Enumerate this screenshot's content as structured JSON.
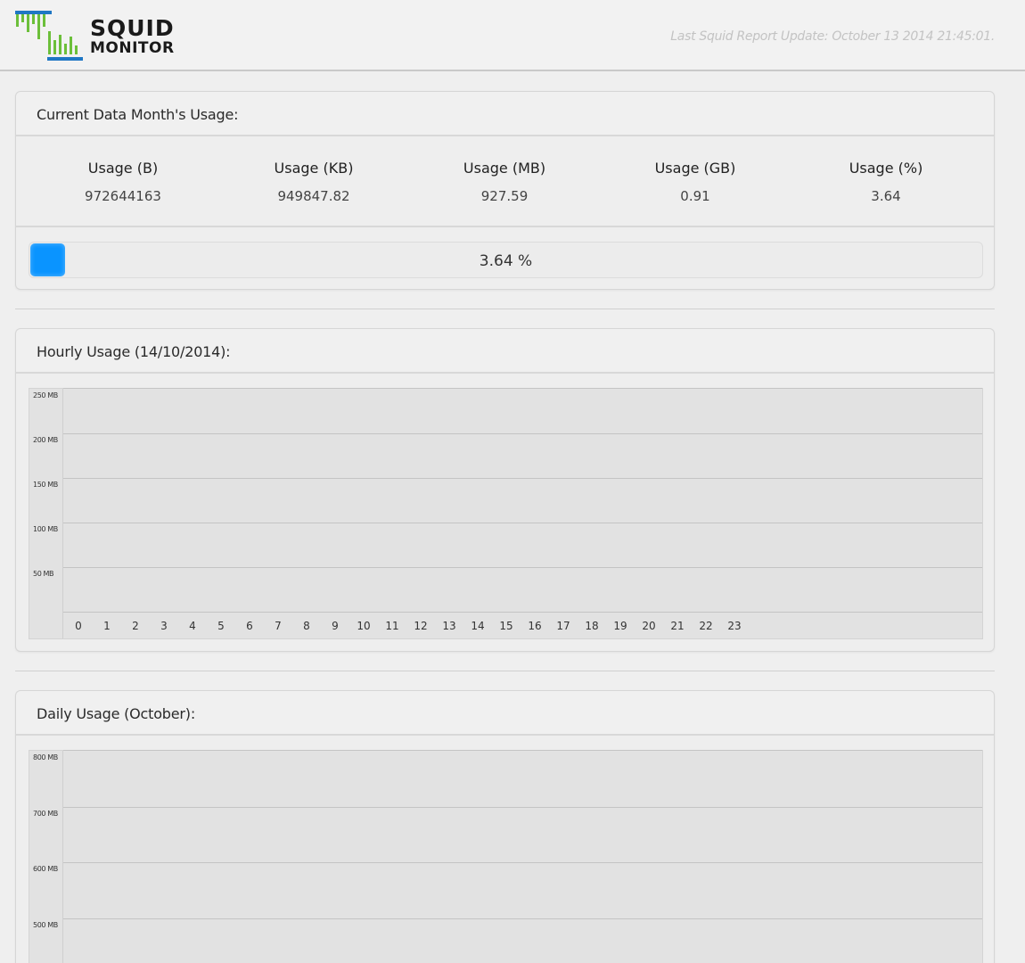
{
  "header": {
    "logo_line1": "SQUID",
    "logo_line2": "MONITOR",
    "last_update": "Last Squid Report Update: October 13 2014 21:45:01.",
    "colors": {
      "logo_green": "#6cbf3a",
      "logo_blue": "#1f77c4"
    }
  },
  "monthly": {
    "title": "Current Data Month's Usage:",
    "stats": [
      {
        "label": "Usage (B)",
        "value": "972644163"
      },
      {
        "label": "Usage (KB)",
        "value": "949847.82"
      },
      {
        "label": "Usage (MB)",
        "value": "927.59"
      },
      {
        "label": "Usage (GB)",
        "value": "0.91"
      },
      {
        "label": "Usage (%)",
        "value": "3.64"
      }
    ],
    "progress": {
      "percent": 3.64,
      "label": "3.64 %",
      "color": "#0a94ff"
    }
  },
  "hourly": {
    "title": "Hourly Usage (14/10/2014):"
  },
  "daily": {
    "title": "Daily Usage (October):"
  },
  "chart_data": [
    {
      "type": "bar",
      "title": "Hourly Usage (14/10/2014):",
      "categories": [
        "0",
        "1",
        "2",
        "3",
        "4",
        "5",
        "6",
        "7",
        "8",
        "9",
        "10",
        "11",
        "12",
        "13",
        "14",
        "15",
        "16",
        "17",
        "18",
        "19",
        "20",
        "21",
        "22",
        "23"
      ],
      "values": [
        0,
        0,
        0,
        0,
        0,
        0,
        0,
        0,
        0,
        0,
        0,
        0,
        0,
        0,
        0,
        0,
        0,
        0,
        0,
        0,
        0,
        0,
        0,
        0
      ],
      "y_tick_labels": [
        "250 MB",
        "200 MB",
        "150 MB",
        "100 MB",
        "50 MB"
      ],
      "ylim": [
        0,
        250
      ],
      "grid": true
    },
    {
      "type": "bar",
      "title": "Daily Usage (October):",
      "y_tick_labels": [
        "800 MB",
        "700 MB",
        "600 MB",
        "500 MB"
      ],
      "grid": true
    }
  ]
}
